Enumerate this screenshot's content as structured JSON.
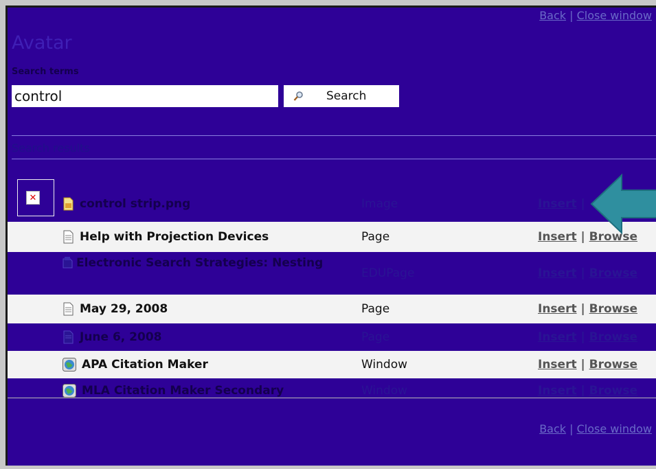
{
  "nav": {
    "back": "Back",
    "sep": "|",
    "close": "Close window"
  },
  "title": "Avatar",
  "search": {
    "label": "Search terms",
    "value": "control",
    "button": "Search"
  },
  "results_label": "Search results",
  "results": [
    {
      "name": "control strip.png",
      "type": "Image",
      "insert": "Insert",
      "sep": "|",
      "browse": "",
      "icon": "image-file-icon",
      "style": "dark"
    },
    {
      "name": "Help with Projection Devices",
      "type": "Page",
      "insert": "Insert",
      "sep": "|",
      "browse": "Browse",
      "icon": "page-icon",
      "style": "light"
    },
    {
      "name": "Electronic Search Strategies: Nesting",
      "type": "EDUPage",
      "insert": "Insert",
      "sep": "|",
      "browse": "Browse",
      "icon": "edupage-icon",
      "style": "dark"
    },
    {
      "name": "May 29, 2008",
      "type": "Page",
      "insert": "Insert",
      "sep": "|",
      "browse": "Browse",
      "icon": "page-icon",
      "style": "light"
    },
    {
      "name": "June 6, 2008",
      "type": "Page",
      "insert": "Insert",
      "sep": "|",
      "browse": "Browse",
      "icon": "page-icon",
      "style": "dark"
    },
    {
      "name": "APA Citation Maker",
      "type": "Window",
      "insert": "Insert",
      "sep": "|",
      "browse": "Browse",
      "icon": "globe-icon",
      "style": "light"
    },
    {
      "name": "MLA Citation Maker Secondary",
      "type": "Window",
      "insert": "Insert",
      "sep": "|",
      "browse": "Browse",
      "icon": "globe-icon",
      "style": "dark"
    }
  ],
  "colors": {
    "background": "#2e0197",
    "light_row": "#f3f3f3",
    "arrow": "#2f8f9f"
  }
}
